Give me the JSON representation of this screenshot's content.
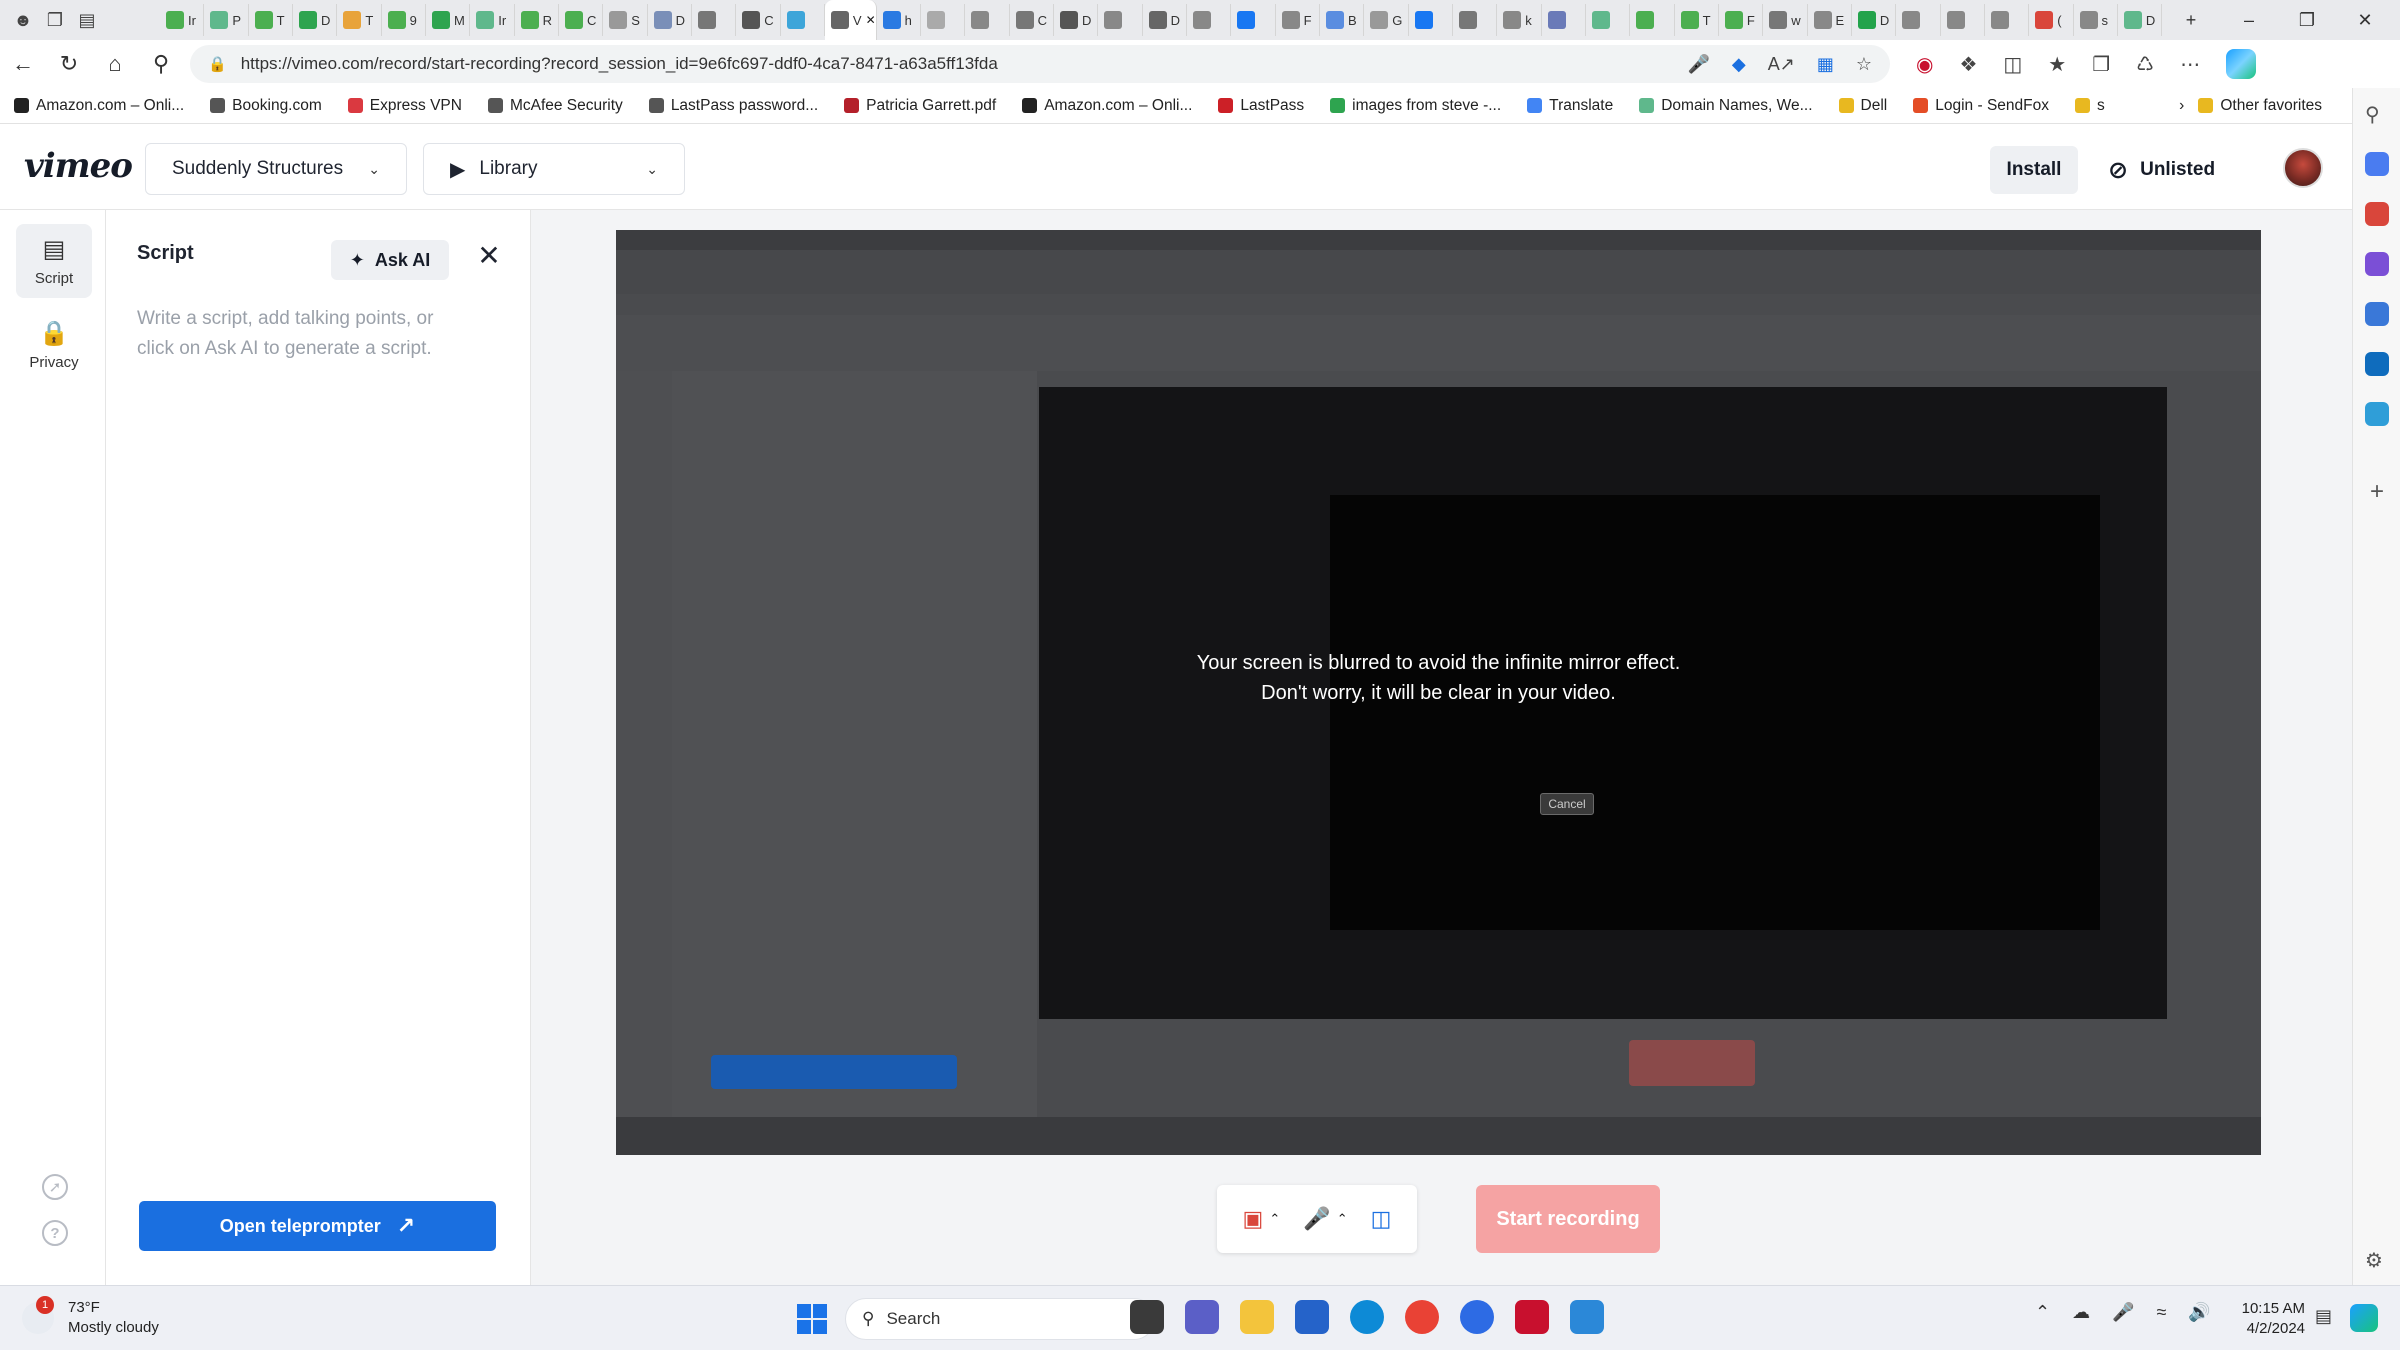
{
  "browser": {
    "url": "https://vimeo.com/record/start-recording?record_session_id=9e6fc697-ddf0-4ca7-8471-a63a5ff13fda",
    "tab_letters": [
      "Ir",
      "P",
      "T",
      "D",
      "T",
      "9",
      "M",
      "Ir",
      "R",
      "C",
      "S",
      "D",
      "",
      "C",
      "",
      "V",
      "h",
      "",
      "",
      "C",
      "D",
      "",
      "D",
      "",
      "",
      "F",
      "B",
      "G",
      "",
      "",
      "k",
      "",
      "",
      "",
      "T",
      "F",
      "w",
      "E",
      "D",
      "",
      "",
      "",
      "(",
      "s",
      "D"
    ]
  },
  "bookmarks": [
    {
      "label": "Amazon.com – Onli...",
      "color": "#222222"
    },
    {
      "label": "Booking.com",
      "color": "#555555"
    },
    {
      "label": "Express VPN",
      "color": "#da3940"
    },
    {
      "label": "McAfee Security",
      "color": "#555555"
    },
    {
      "label": "LastPass password...",
      "color": "#555555"
    },
    {
      "label": "Patricia Garrett.pdf",
      "color": "#b4202a"
    },
    {
      "label": "Amazon.com – Onli...",
      "color": "#222222"
    },
    {
      "label": "LastPass",
      "color": "#cc2027"
    },
    {
      "label": "images from steve -...",
      "color": "#2ea44f"
    },
    {
      "label": "Translate",
      "color": "#4285f4"
    },
    {
      "label": "Domain Names, We...",
      "color": "#5fb88c"
    },
    {
      "label": "Dell",
      "color": "#e8b820"
    },
    {
      "label": "Login - SendFox",
      "color": "#e44d26"
    },
    {
      "label": "s",
      "color": "#e8b820"
    }
  ],
  "bookmarks_other": "Other favorites",
  "header": {
    "logo": "vimeo",
    "project": "Suddenly Structures",
    "library": "Library",
    "install": "Install",
    "unlisted": "Unlisted"
  },
  "rail": {
    "script": "Script",
    "privacy": "Privacy"
  },
  "script_panel": {
    "title": "Script",
    "ask_ai": "Ask AI",
    "placeholder": "Write a script, add talking points, or click on Ask AI to generate a script.",
    "teleprompter": "Open teleprompter"
  },
  "preview": {
    "message_line1": "Your screen is blurred to avoid the infinite mirror effect.",
    "message_line2": "Don't worry, it will be clear in your video.",
    "cancel": "Cancel"
  },
  "record": {
    "start": "Start recording"
  },
  "taskbar": {
    "temperature": "73°F",
    "weather": "Mostly cloudy",
    "weather_badge": "1",
    "search": "Search",
    "time": "10:15 AM",
    "date": "4/2/2024"
  }
}
